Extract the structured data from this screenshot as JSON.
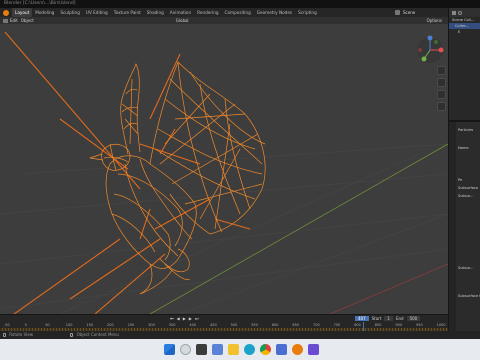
{
  "window": {
    "title": "Blender [C:\\Users\\...\\Bird.blend]"
  },
  "menu": {
    "tabs": [
      "Layout",
      "Modeling",
      "Sculpting",
      "UV Editing",
      "Texture Paint",
      "Shading",
      "Animation",
      "Rendering",
      "Compositing",
      "Geometry Nodes",
      "Scripting"
    ],
    "active_tab": "Layout"
  },
  "header": {
    "edit": "Edit",
    "object": "Object",
    "transform": "Global",
    "options": "Options"
  },
  "scene": {
    "name": "Scene"
  },
  "outliner": {
    "items": [
      "Scene Coll...",
      "Collec...",
      "E"
    ]
  },
  "properties": {
    "items": [
      "Particles",
      "Name",
      "Pe",
      "Subsurface",
      "Subsur...",
      "Subsur...",
      "Subsurface Rad"
    ]
  },
  "timeline": {
    "ticks": [
      "-50",
      "0",
      "50",
      "100",
      "150",
      "200",
      "250",
      "300",
      "350",
      "400",
      "450",
      "500",
      "550",
      "600",
      "650",
      "700",
      "750",
      "800",
      "850",
      "900",
      "950",
      "1000"
    ],
    "current_frame": "407",
    "start_label": "Start",
    "start_value": "1",
    "end_label": "End",
    "end_value": "500"
  },
  "status": {
    "left": "Rotate View",
    "middle": "Object Context Menu"
  },
  "colors": {
    "wire": "#f28a2a",
    "hair": "#e26a1c",
    "viewport": "#3d3d3d",
    "grid_x": "#8a3d3d",
    "grid_y": "#6f8f3a",
    "accent": "#4772b3"
  }
}
